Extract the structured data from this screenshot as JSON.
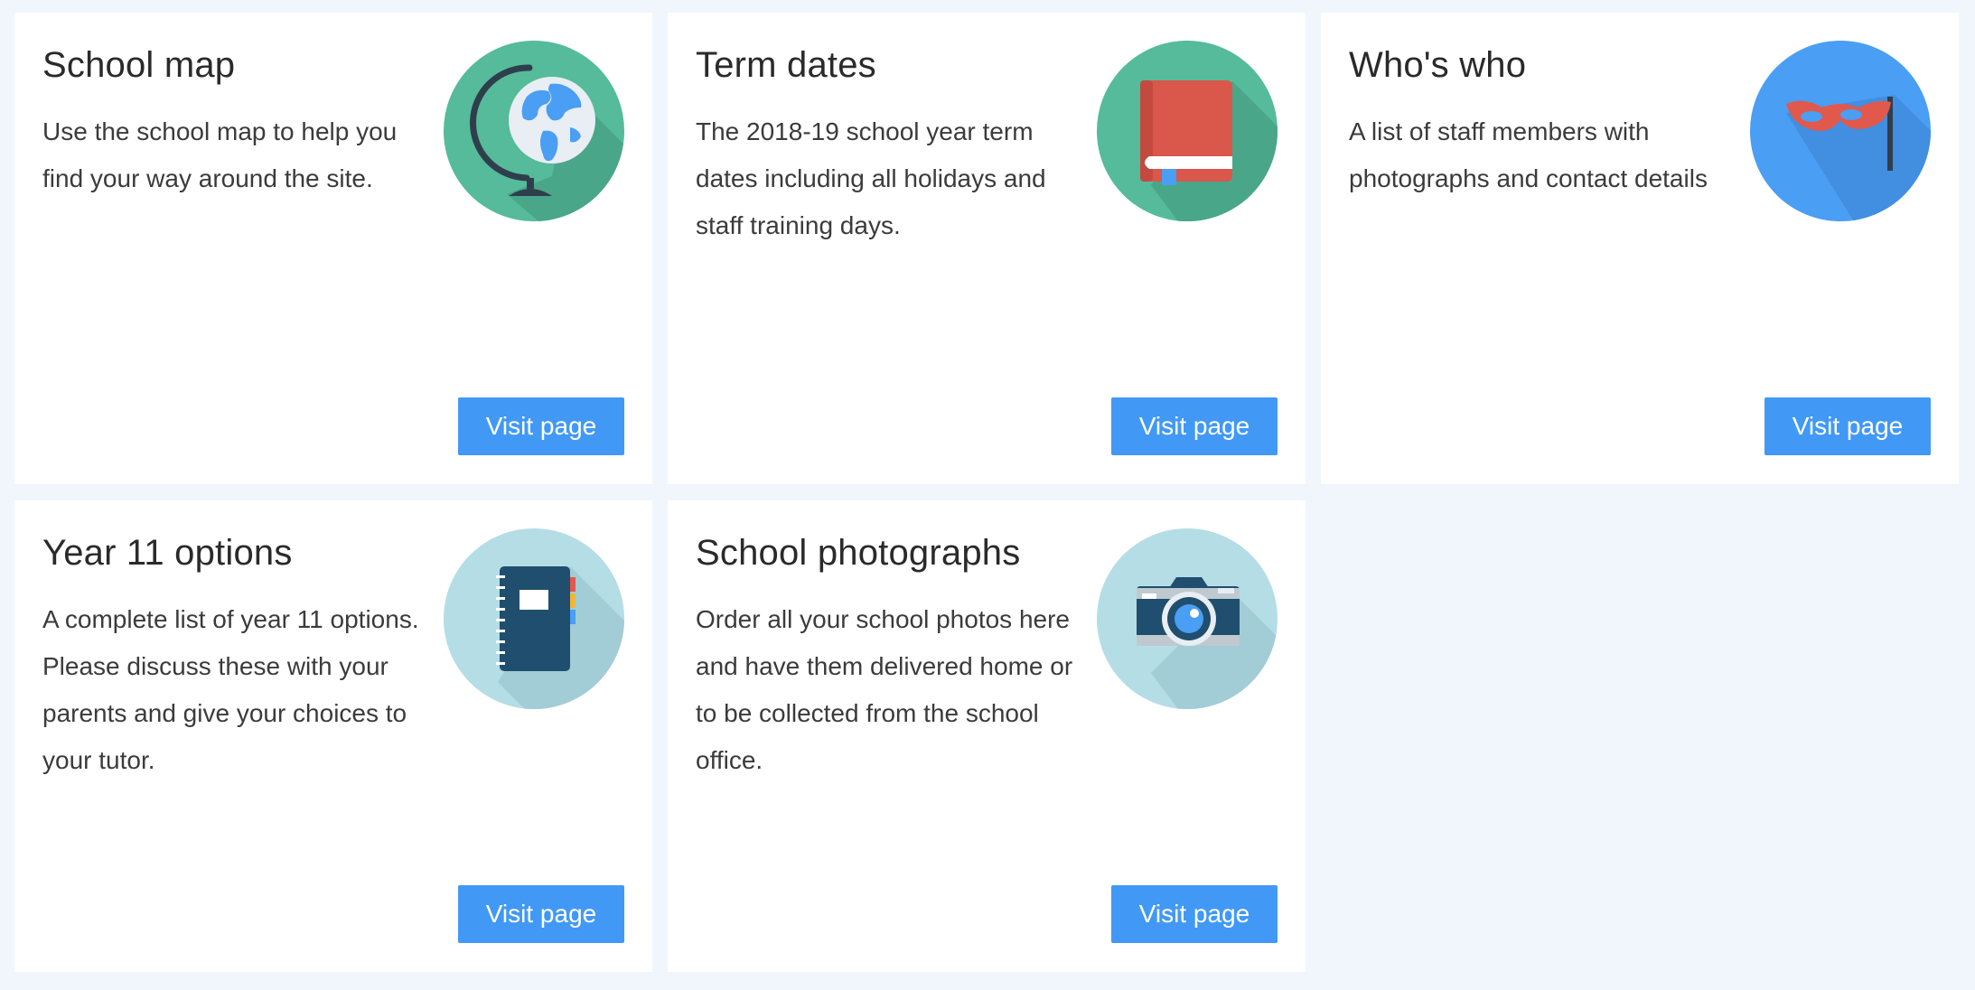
{
  "cards": [
    {
      "title": "School map",
      "description": "Use the school map to help you find your way around the site.",
      "icon": "globe-icon",
      "button_label": "Visit page"
    },
    {
      "title": "Term dates",
      "description": "The 2018-19 school year term dates including all holidays and staff training days.",
      "icon": "book-icon",
      "button_label": "Visit page"
    },
    {
      "title": "Who's who",
      "description": "A list of staff members with photographs and contact details",
      "icon": "mask-icon",
      "button_label": "Visit page"
    },
    {
      "title": "Year 11 options",
      "description": "A complete list of year 11 options. Please discuss these with your parents and give your choices to your tutor.",
      "icon": "notebook-icon",
      "button_label": "Visit page"
    },
    {
      "title": "School photographs",
      "description": "Order all your school photos here and have them delivered home or to be collected from the school office.",
      "icon": "camera-icon",
      "button_label": "Visit page"
    }
  ],
  "colors": {
    "page_background": "#f0f6fc",
    "card_background": "#ffffff",
    "button": "#4199f5",
    "icon_green": "#55bb9a",
    "icon_blue": "#4a9ef3",
    "icon_light_blue": "#b5dde6"
  }
}
